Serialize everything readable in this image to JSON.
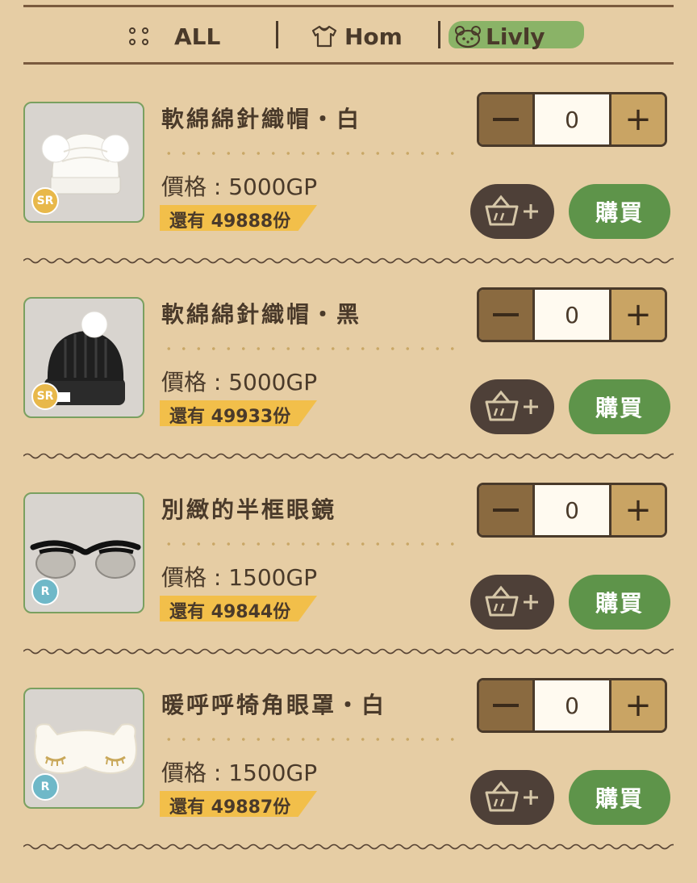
{
  "tabs": [
    {
      "label": "ALL",
      "icon": "grid-dots-icon"
    },
    {
      "label": "Hom",
      "icon": "shirt-icon"
    },
    {
      "label": "Livly",
      "icon": "livly-face-icon",
      "active": true
    }
  ],
  "items": [
    {
      "name": "軟綿綿針織帽・白",
      "price": "價格 : 5000GP",
      "stock": "還有 49888份",
      "qty": "0",
      "rarity": "SR",
      "buy_label": "購買"
    },
    {
      "name": "軟綿綿針織帽・黑",
      "price": "價格 : 5000GP",
      "stock": "還有 49933份",
      "qty": "0",
      "rarity": "SR",
      "buy_label": "購買"
    },
    {
      "name": "別緻的半框眼鏡",
      "price": "價格 : 1500GP",
      "stock": "還有 49844份",
      "qty": "0",
      "rarity": "R",
      "buy_label": "購買"
    },
    {
      "name": "暖呼呼犄角眼罩・白",
      "price": "價格 : 1500GP",
      "stock": "還有 49887份",
      "qty": "0",
      "rarity": "R",
      "buy_label": "購買"
    }
  ],
  "colors": {
    "background": "#e6cda4",
    "buy_button": "#5e944a",
    "stock_badge": "#f2bf4a",
    "active_tab": "#7fb060"
  }
}
